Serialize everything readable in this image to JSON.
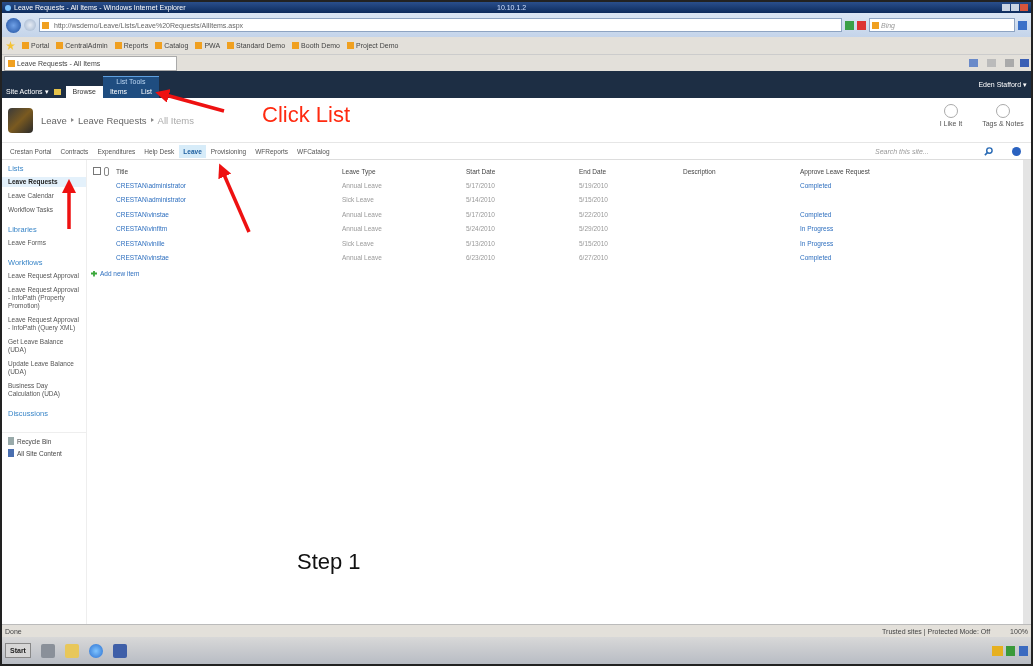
{
  "browser": {
    "title": "Leave Requests - All Items - Windows Internet Explorer",
    "remote_host": "10.10.1.2",
    "address": "http://wsdemo/Leave/Lists/Leave%20Requests/AllItems.aspx",
    "search_placeholder": "Bing",
    "favorites": [
      "Portal",
      "CentralAdmin",
      "Reports",
      "Catalog",
      "PWA",
      "Standard Demo",
      "Booth Demo",
      "Project Demo"
    ],
    "tab": "Leave Requests - All Items"
  },
  "ribbon": {
    "site_actions": "Site Actions ▾",
    "group": "List Tools",
    "tabs": [
      {
        "label": "Browse",
        "selected": true
      },
      {
        "label": "Items",
        "selected": false
      },
      {
        "label": "List",
        "selected": false
      }
    ],
    "user": "Eden Stafford ▾"
  },
  "header": {
    "breadcrumb": [
      "Leave",
      "Leave Requests",
      "All Items"
    ],
    "actions": [
      "I Like It",
      "Tags & Notes"
    ]
  },
  "topnav": {
    "items": [
      {
        "label": "Crestan Portal",
        "selected": false
      },
      {
        "label": "Contracts",
        "selected": false
      },
      {
        "label": "Expenditures",
        "selected": false
      },
      {
        "label": "Help Desk",
        "selected": false
      },
      {
        "label": "Leave",
        "selected": true
      },
      {
        "label": "Provisioning",
        "selected": false
      },
      {
        "label": "WFReports",
        "selected": false
      },
      {
        "label": "WFCatalog",
        "selected": false
      }
    ],
    "search_placeholder": "Search this site..."
  },
  "quicklaunch": {
    "sections": [
      {
        "heading": "Lists",
        "items": [
          {
            "label": "Leave Requests",
            "selected": true
          },
          {
            "label": "Leave Calendar",
            "selected": false
          },
          {
            "label": "Workflow Tasks",
            "selected": false
          }
        ]
      },
      {
        "heading": "Libraries",
        "items": [
          {
            "label": "Leave Forms",
            "selected": false
          }
        ]
      },
      {
        "heading": "Workflows",
        "items": [
          {
            "label": "Leave Request Approval",
            "selected": false
          },
          {
            "label": "Leave Request Approval - InfoPath (Property Promotion)",
            "selected": false
          },
          {
            "label": "Leave Request Approval - InfoPath (Query XML)",
            "selected": false
          },
          {
            "label": "Get Leave Balance (UDA)",
            "selected": false
          },
          {
            "label": "Update Leave Balance (UDA)",
            "selected": false
          },
          {
            "label": "Business Day Calculation (UDA)",
            "selected": false
          }
        ]
      },
      {
        "heading": "Discussions"
      }
    ],
    "footer": [
      "Recycle Bin",
      "All Site Content"
    ]
  },
  "table": {
    "select_all_checked": false,
    "columns": [
      "Title",
      "Leave Type",
      "Start Date",
      "End Date",
      "Description",
      "Approve Leave Request"
    ],
    "rows": [
      [
        "CRESTAN\\administrator",
        "Annual Leave",
        "5/17/2010",
        "5/19/2010",
        "",
        "Completed"
      ],
      [
        "CRESTAN\\administrator",
        "Sick Leave",
        "5/14/2010",
        "5/15/2010",
        "",
        ""
      ],
      [
        "CRESTAN\\vinstae",
        "Annual Leave",
        "5/17/2010",
        "5/22/2010",
        "",
        "Completed"
      ],
      [
        "CRESTAN\\vinfitm",
        "Annual Leave",
        "5/24/2010",
        "5/29/2010",
        "",
        "In Progress"
      ],
      [
        "CRESTAN\\vinille",
        "Sick Leave",
        "5/13/2010",
        "5/15/2010",
        "",
        "In Progress"
      ],
      [
        "CRESTAN\\vinstae",
        "Annual Leave",
        "6/23/2010",
        "6/27/2010",
        "",
        "Completed"
      ]
    ],
    "add_new": "Add new item"
  },
  "status_bar": {
    "text": "Done",
    "zone": "Trusted sites | Protected Mode: Off",
    "zoom": "100%"
  },
  "taskbar": {
    "start": "Start"
  },
  "annotations": [
    "Click List",
    "Step 1"
  ]
}
